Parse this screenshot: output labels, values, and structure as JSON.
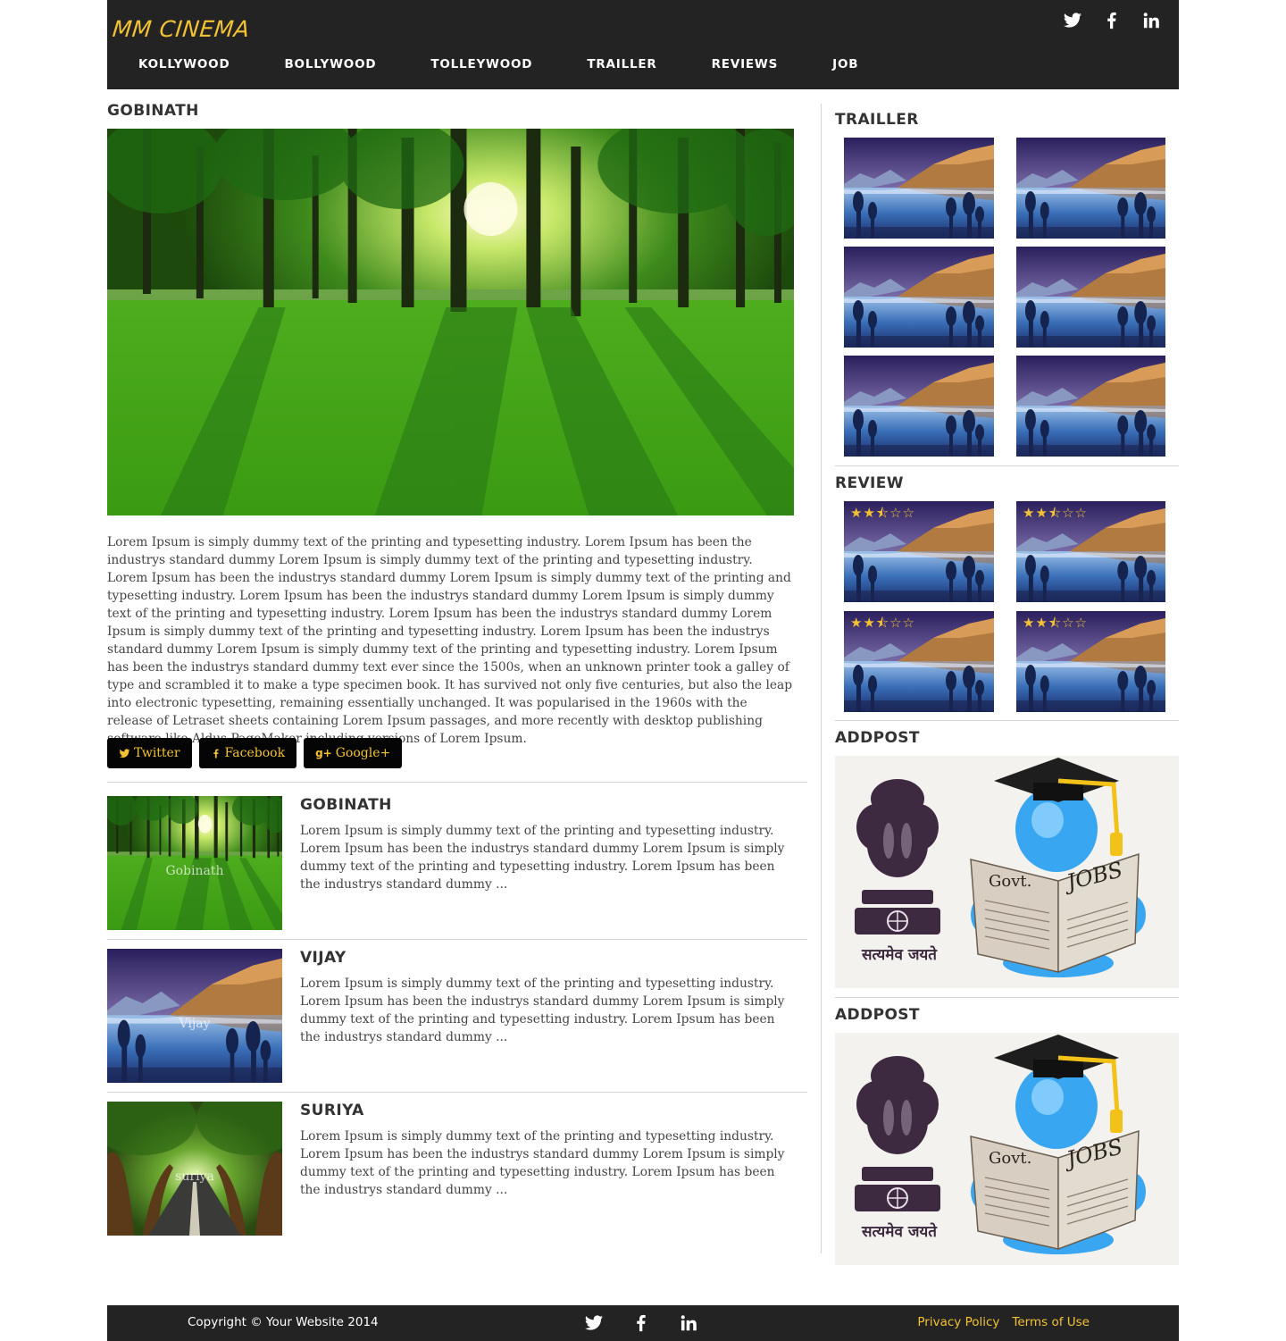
{
  "header": {
    "logo": "MM CINEMA",
    "nav": [
      "KOLLYWOOD",
      "BOLLYWOOD",
      "TOLLEYWOOD",
      "TRAILLER",
      "REVIEWS",
      "JOB"
    ],
    "social_icons": [
      "twitter-icon",
      "facebook-icon",
      "linkedin-icon"
    ]
  },
  "article": {
    "title": "GOBINATH",
    "hero_image": "forest-sunlight",
    "body": "Lorem Ipsum is simply dummy text of the printing and typesetting industry. Lorem Ipsum has been the industrys standard dummy Lorem Ipsum is simply dummy text of the printing and typesetting industry. Lorem Ipsum has been the industrys standard dummy Lorem Ipsum is simply dummy text of the printing and typesetting industry. Lorem Ipsum has been the industrys standard dummy Lorem Ipsum is simply dummy text of the printing and typesetting industry. Lorem Ipsum has been the industrys standard dummy Lorem Ipsum is simply dummy text of the printing and typesetting industry. Lorem Ipsum has been the industrys standard dummy Lorem Ipsum is simply dummy text of the printing and typesetting industry. Lorem Ipsum has been the industrys standard dummy text ever since the 1500s, when an unknown printer took a galley of type and scrambled it to make a type specimen book. It has survived not only five centuries, but also the leap into electronic typesetting, remaining essentially unchanged. It was popularised in the 1960s with the release of Letraset sheets containing Lorem Ipsum passages, and more recently with desktop publishing software like Aldus PageMaker including versions of Lorem Ipsum.",
    "share": {
      "twitter": "Twitter",
      "facebook": "Facebook",
      "google": "Google+"
    }
  },
  "posts": [
    {
      "title": "GOBINATH",
      "caption": "Gobinath",
      "image": "forest",
      "text": "Lorem Ipsum is simply dummy text of the printing and typesetting industry. Lorem Ipsum has been the industrys standard dummy Lorem Ipsum is simply dummy text of the printing and typesetting industry. Lorem Ipsum has been the industrys standard dummy ..."
    },
    {
      "title": "VIJAY",
      "caption": "Vijay",
      "image": "lake",
      "text": "Lorem Ipsum is simply dummy text of the printing and typesetting industry. Lorem Ipsum has been the industrys standard dummy Lorem Ipsum is simply dummy text of the printing and typesetting industry. Lorem Ipsum has been the industrys standard dummy ..."
    },
    {
      "title": "SURIYA",
      "caption": "suriya",
      "image": "road",
      "text": "Lorem Ipsum is simply dummy text of the printing and typesetting industry. Lorem Ipsum has been the industrys standard dummy Lorem Ipsum is simply dummy text of the printing and typesetting industry. Lorem Ipsum has been the industrys standard dummy ..."
    }
  ],
  "sidebar": {
    "trailer_title": "TRAILLER",
    "review_title": "REVIEW",
    "review_rating": 2.5,
    "review_max": 5,
    "ads": [
      {
        "title": "ADDPOST",
        "image_text": "Govt.",
        "image_text2": "JOBS",
        "motto": "सत्यमेव जयते"
      },
      {
        "title": "ADDPOST",
        "image_text": "Govt.",
        "image_text2": "JOBS",
        "motto": "सत्यमेव जयते"
      }
    ]
  },
  "footer": {
    "copyright": "Copyright © Your Website 2014",
    "links": [
      "Privacy Policy",
      "Terms of Use"
    ]
  },
  "colors": {
    "accent": "#f3c234",
    "header_bg": "#232323",
    "button_bg": "#050505"
  }
}
